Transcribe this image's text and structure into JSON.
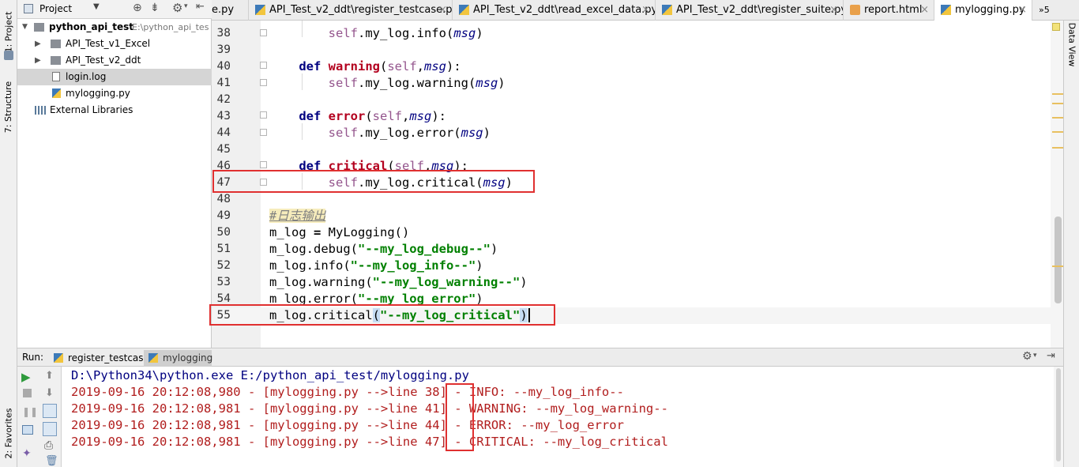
{
  "left_strip": {
    "project_tab": "1: Project",
    "structure_tab": "7: Structure",
    "favorites_tab": "2: Favorites"
  },
  "right_strip": {
    "data_view_tab": "Data View"
  },
  "project_panel": {
    "header_label": "Project",
    "tree": [
      {
        "label": "python_api_test",
        "path": "E:\\python_api_tes"
      },
      {
        "label": "API_Test_v1_Excel"
      },
      {
        "label": "API_Test_v2_ddt"
      },
      {
        "label": "login.log"
      },
      {
        "label": "mylogging.py"
      },
      {
        "label": "External Libraries"
      }
    ]
  },
  "tabs": [
    {
      "label": "e.py"
    },
    {
      "label": "API_Test_v2_ddt\\register_testcase.py"
    },
    {
      "label": "API_Test_v2_ddt\\read_excel_data.py"
    },
    {
      "label": "API_Test_v2_ddt\\register_suite.py"
    },
    {
      "label": "report.html"
    },
    {
      "label": "mylogging.py"
    },
    {
      "label": "»5"
    }
  ],
  "editor": {
    "line_numbers": [
      "38",
      "39",
      "40",
      "41",
      "42",
      "43",
      "44",
      "45",
      "46",
      "47",
      "48",
      "49",
      "50",
      "51",
      "52",
      "53",
      "54",
      "55"
    ],
    "lines": {
      "l38": {
        "a": "self",
        "b": ".my_log.info(",
        "c": "msg",
        "d": ")"
      },
      "l40": {
        "kw": "def ",
        "fn": "warning",
        "p1": "(",
        "self": "self",
        "p2": ",",
        "msg": "msg",
        "p3": "):"
      },
      "l41": {
        "a": "self",
        "b": ".my_log.warning(",
        "c": "msg",
        "d": ")"
      },
      "l43": {
        "kw": "def ",
        "fn": "error",
        "p1": "(",
        "self": "self",
        "p2": ",",
        "msg": "msg",
        "p3": "):"
      },
      "l44": {
        "a": "self",
        "b": ".my_log.error(",
        "c": "msg",
        "d": ")"
      },
      "l46": {
        "kw": "def ",
        "fn": "critical",
        "p1": "(",
        "self": "self",
        "p2": ",",
        "msg": "msg",
        "p3": "):"
      },
      "l47": {
        "a": "self",
        "b": ".my_log.critical(",
        "c": "msg",
        "d": ")"
      },
      "l49": {
        "comment": "#日志输出"
      },
      "l50": {
        "a": "m_log ",
        "b": "= ",
        "c": "MyLogging()"
      },
      "l51": {
        "a": "m_log.debug(",
        "s": "\"--my_log_debug--\"",
        "e": ")"
      },
      "l52": {
        "a": "m_log.info(",
        "s": "\"--my_log_info--\"",
        "e": ")"
      },
      "l53": {
        "a": "m_log.warning(",
        "s": "\"--my_log_warning--\"",
        "e": ")"
      },
      "l54": {
        "a": "m_log.error(",
        "s": "\"--my_log_error\"",
        "e": ")"
      },
      "l55": {
        "a": "m_log.critical",
        "p": "(",
        "s": "\"--my_log_critical\"",
        "e": ")"
      }
    }
  },
  "run_panel": {
    "label": "Run:",
    "tabs": [
      {
        "label": "register_testcase"
      },
      {
        "label": "mylogging"
      }
    ],
    "console": [
      {
        "text": "D:\\Python34\\python.exe E:/python_api_test/mylogging.py"
      },
      {
        "pre": "2019-09-16 20:12:08,980 - [mylogging.py -->line ",
        "num": "38",
        "post": "] - INFO: --my_log_info--"
      },
      {
        "pre": "2019-09-16 20:12:08,981 - [mylogging.py -->line ",
        "num": "41",
        "post": "] - WARNING: --my_log_warning--"
      },
      {
        "pre": "2019-09-16 20:12:08,981 - [mylogging.py -->line ",
        "num": "44",
        "post": "] - ERROR: --my_log_error"
      },
      {
        "pre": "2019-09-16 20:12:08,981 - [mylogging.py -->line ",
        "num": "47",
        "post": "] - CRITICAL: --my_log_critical"
      }
    ]
  },
  "colors": {
    "keyword": "#000080",
    "function_name": "#b3001e",
    "self": "#94558d",
    "string": "#008000",
    "console_text": "#b11d1d",
    "highlight_box": "#e03030"
  }
}
